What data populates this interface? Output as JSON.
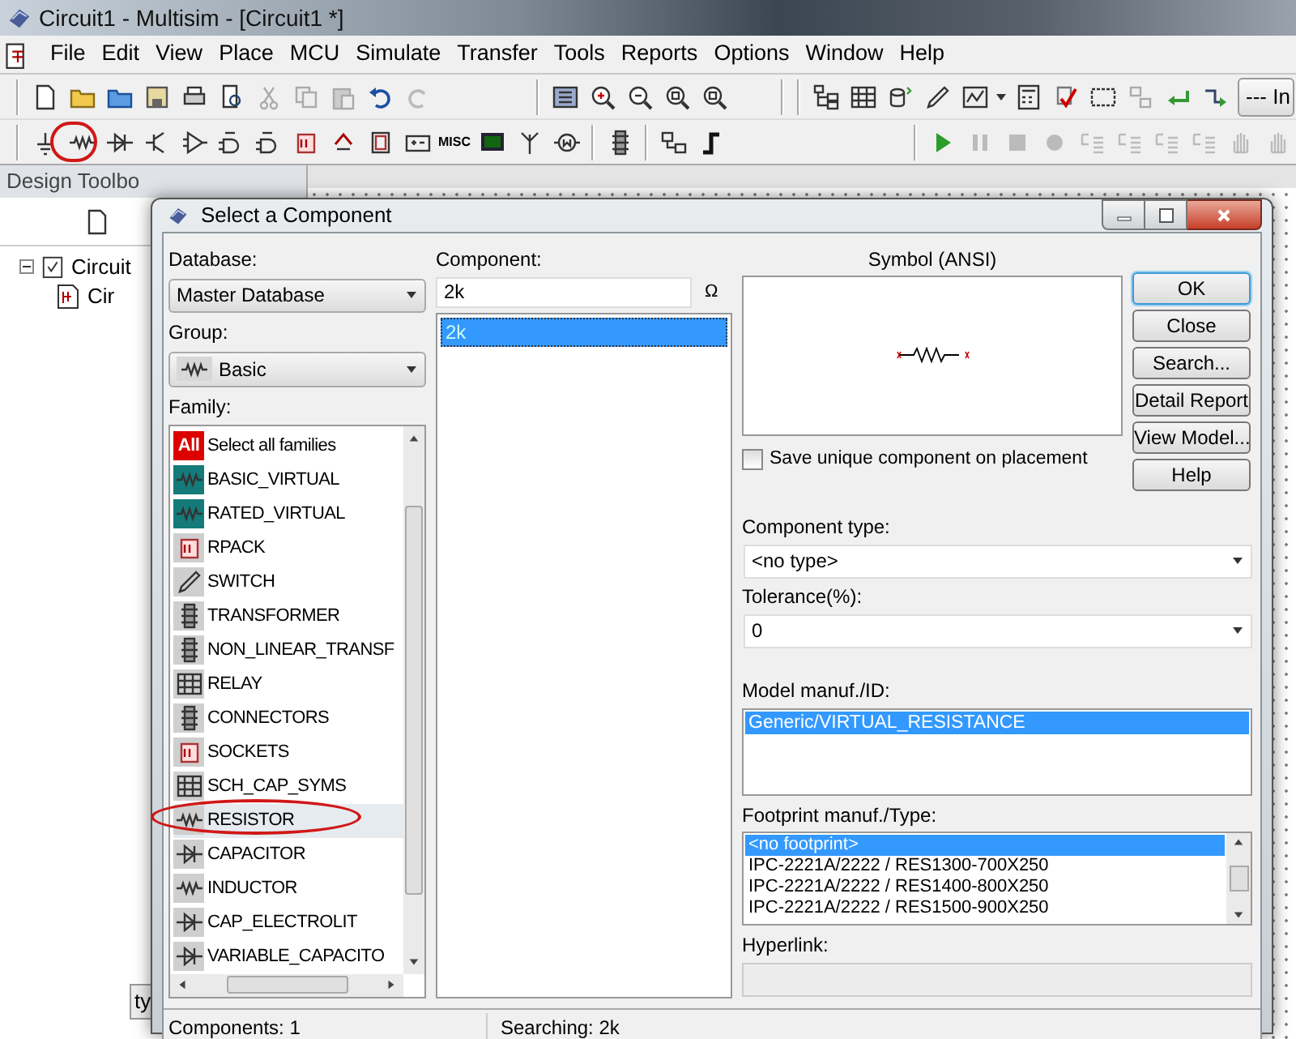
{
  "window": {
    "title": "Circuit1 - Multisim - [Circuit1 *]"
  },
  "menu": [
    "File",
    "Edit",
    "View",
    "Place",
    "MCU",
    "Simulate",
    "Transfer",
    "Tools",
    "Reports",
    "Options",
    "Window",
    "Help"
  ],
  "toolbar": {
    "misc_label": "MISC",
    "combo_value": "--- In"
  },
  "design_toolbox": {
    "title": "Design Toolbo",
    "tree": [
      {
        "label": "Circuit",
        "expanded": true,
        "children": [
          {
            "label": "Cir"
          }
        ]
      }
    ],
    "tab": "ty"
  },
  "dialog": {
    "title": "Select a Component",
    "database": {
      "label": "Database:",
      "value": "Master Database"
    },
    "group": {
      "label": "Group:",
      "value": "Basic"
    },
    "family": {
      "label": "Family:",
      "items": [
        {
          "label": "Select all families",
          "icon_text": "All",
          "selected": false
        },
        {
          "label": "BASIC_VIRTUAL",
          "selected": false
        },
        {
          "label": "RATED_VIRTUAL",
          "selected": false
        },
        {
          "label": "RPACK",
          "selected": false
        },
        {
          "label": "SWITCH",
          "selected": false
        },
        {
          "label": "TRANSFORMER",
          "selected": false
        },
        {
          "label": "NON_LINEAR_TRANSF",
          "selected": false
        },
        {
          "label": "RELAY",
          "selected": false
        },
        {
          "label": "CONNECTORS",
          "selected": false
        },
        {
          "label": "SOCKETS",
          "selected": false
        },
        {
          "label": "SCH_CAP_SYMS",
          "selected": false
        },
        {
          "label": "RESISTOR",
          "selected": true
        },
        {
          "label": "CAPACITOR",
          "selected": false
        },
        {
          "label": "INDUCTOR",
          "selected": false
        },
        {
          "label": "CAP_ELECTROLIT",
          "selected": false
        },
        {
          "label": "VARIABLE_CAPACITO",
          "selected": false
        }
      ]
    },
    "component": {
      "label": "Component:",
      "value": "2k",
      "symbol": "Ω",
      "items": [
        {
          "label": "2k",
          "selected": true
        }
      ]
    },
    "symbol": {
      "label": "Symbol (ANSI)"
    },
    "save_unique": {
      "label": "Save unique component on placement",
      "checked": false
    },
    "component_type": {
      "label": "Component type:",
      "value": "<no type>"
    },
    "tolerance": {
      "label": "Tolerance(%):",
      "value": "0"
    },
    "model": {
      "label": "Model manuf./ID:",
      "items": [
        {
          "label": "Generic/VIRTUAL_RESISTANCE",
          "selected": true
        }
      ]
    },
    "footprint": {
      "label": "Footprint manuf./Type:",
      "items": [
        {
          "label": "<no footprint>",
          "selected": true
        },
        {
          "label": "IPC-2221A/2222 / RES1300-700X250",
          "selected": false
        },
        {
          "label": "IPC-2221A/2222 / RES1400-800X250",
          "selected": false
        },
        {
          "label": "IPC-2221A/2222 / RES1500-900X250",
          "selected": false
        }
      ]
    },
    "hyperlink": {
      "label": "Hyperlink:"
    },
    "buttons": [
      {
        "label": "OK",
        "default": true
      },
      {
        "label": "Close",
        "default": false
      },
      {
        "label": "Search...",
        "default": false
      },
      {
        "label": "Detail Report",
        "default": false
      },
      {
        "label": "View Model...",
        "default": false
      },
      {
        "label": "Help",
        "default": false
      }
    ],
    "status": [
      "Components: 1",
      "Searching: 2k"
    ]
  }
}
